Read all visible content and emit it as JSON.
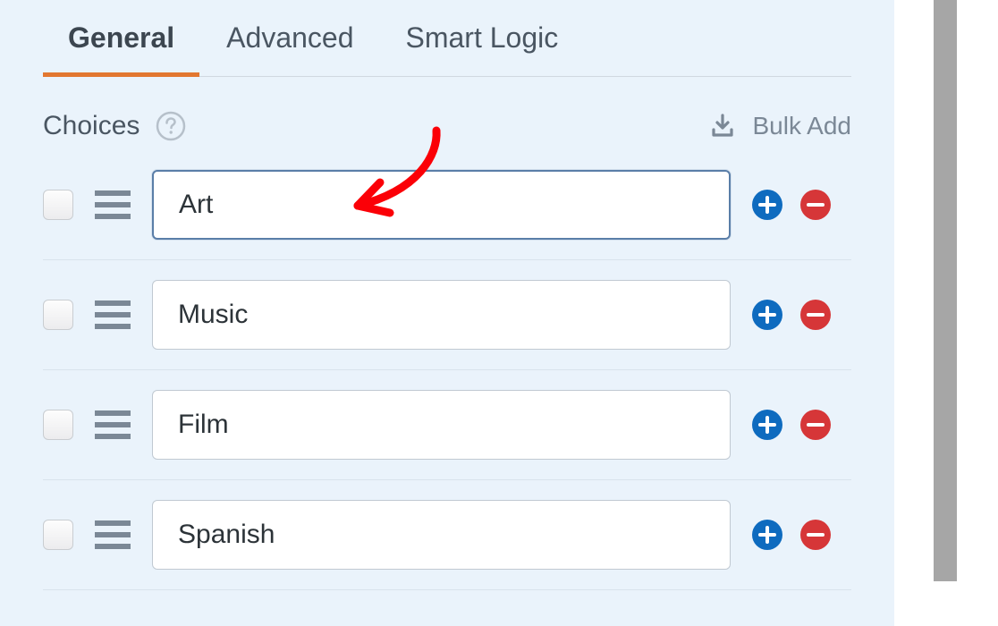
{
  "tabs": {
    "general": "General",
    "advanced": "Advanced",
    "smart_logic": "Smart Logic"
  },
  "choices_header": {
    "label": "Choices",
    "bulk_add": "Bulk Add"
  },
  "choices": [
    {
      "value": "Art"
    },
    {
      "value": "Music"
    },
    {
      "value": "Film"
    },
    {
      "value": "Spanish"
    }
  ],
  "colors": {
    "add": "#0e6bbf",
    "remove": "#d63638",
    "accent": "#e27730",
    "muted": "#7b8896"
  }
}
